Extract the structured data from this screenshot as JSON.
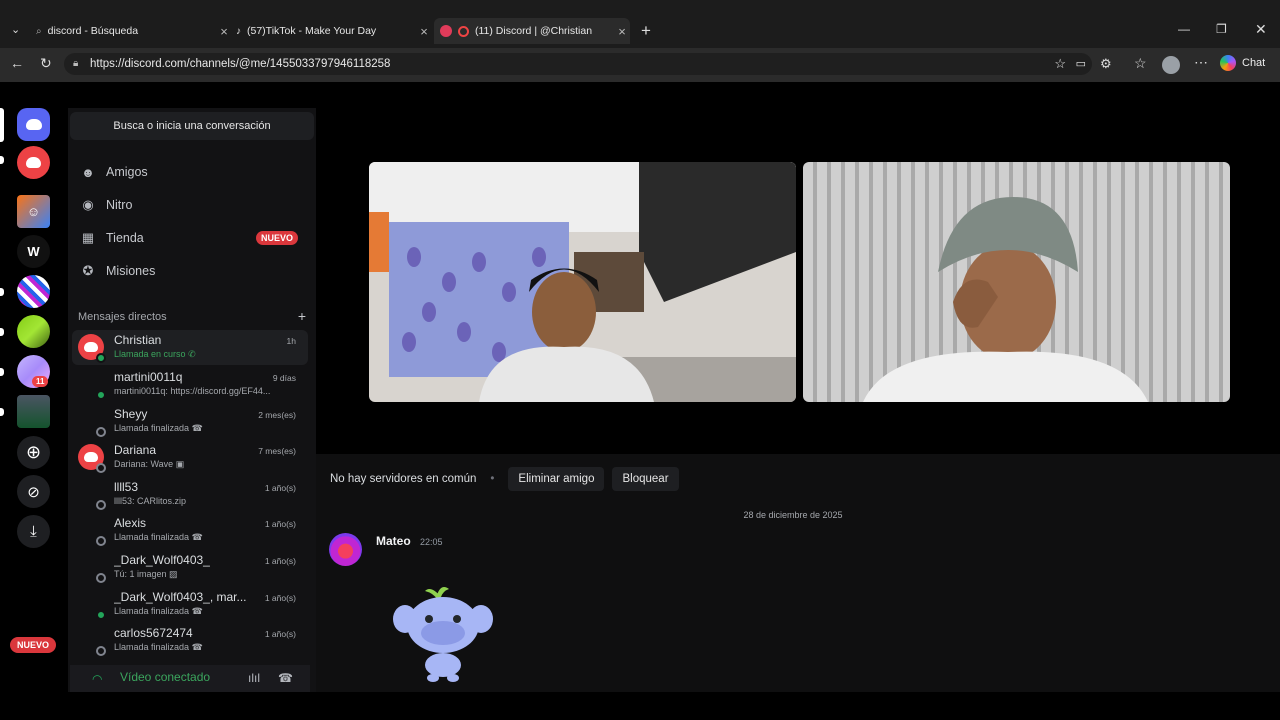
{
  "browser": {
    "tabs": [
      {
        "title": "discord - Búsqueda",
        "icon": "search-icon"
      },
      {
        "title": "(57)TikTok - Make Your Day",
        "icon": "tiktok-icon"
      },
      {
        "title": "(11) Discord | @Christian",
        "icon": "discord-icon"
      }
    ],
    "url": "https://discord.com/channels/@me/1455033797946118258",
    "chat_label": "Chat"
  },
  "servers": {
    "new_badge": "NUEVO",
    "notif_count": "11",
    "w_label": "W"
  },
  "dm_panel": {
    "search_label": "Busca o inicia una conversación",
    "nav": [
      {
        "label": "Amigos",
        "icon": "friends-icon"
      },
      {
        "label": "Nitro",
        "icon": "nitro-icon"
      },
      {
        "label": "Tienda",
        "icon": "shop-icon",
        "badge": "NUEVO"
      },
      {
        "label": "Misiones",
        "icon": "quests-icon"
      }
    ],
    "section_title": "Mensajes directos",
    "add_symbol": "+",
    "dms": [
      {
        "name": "Christian",
        "sub": "Llamada en curso",
        "time": "1h"
      },
      {
        "name": "martini0011q",
        "sub": "martini0011q: https://discord.gg/EF44...",
        "time": "9 días"
      },
      {
        "name": "Sheyy",
        "sub": "Llamada finalizada",
        "time": "2 mes(es)"
      },
      {
        "name": "Dariana",
        "sub": "Dariana: Wave",
        "time": "7 mes(es)"
      },
      {
        "name": "llll53",
        "sub": "llll53: CARlitos.zip",
        "time": "1 año(s)"
      },
      {
        "name": "Alexis",
        "sub": "Llamada finalizada",
        "time": "1 año(s)"
      },
      {
        "name": "_Dark_Wolf0403_",
        "sub": "Tú: 1 imagen",
        "time": "1 año(s)"
      },
      {
        "name": "_Dark_Wolf0403_, mar...",
        "sub": "Llamada finalizada",
        "time": "1 año(s)"
      },
      {
        "name": "carlos5672474",
        "sub": "Llamada finalizada",
        "time": "1 año(s)"
      }
    ],
    "voice_status": "Vídeo conectado"
  },
  "profile_actions": {
    "no_servers": "No hay servidores en común",
    "remove_friend": "Eliminar amigo",
    "block": "Bloquear"
  },
  "chat": {
    "date_divider": "28 de diciembre de 2025",
    "message": {
      "author": "Mateo",
      "time": "22:05"
    }
  }
}
